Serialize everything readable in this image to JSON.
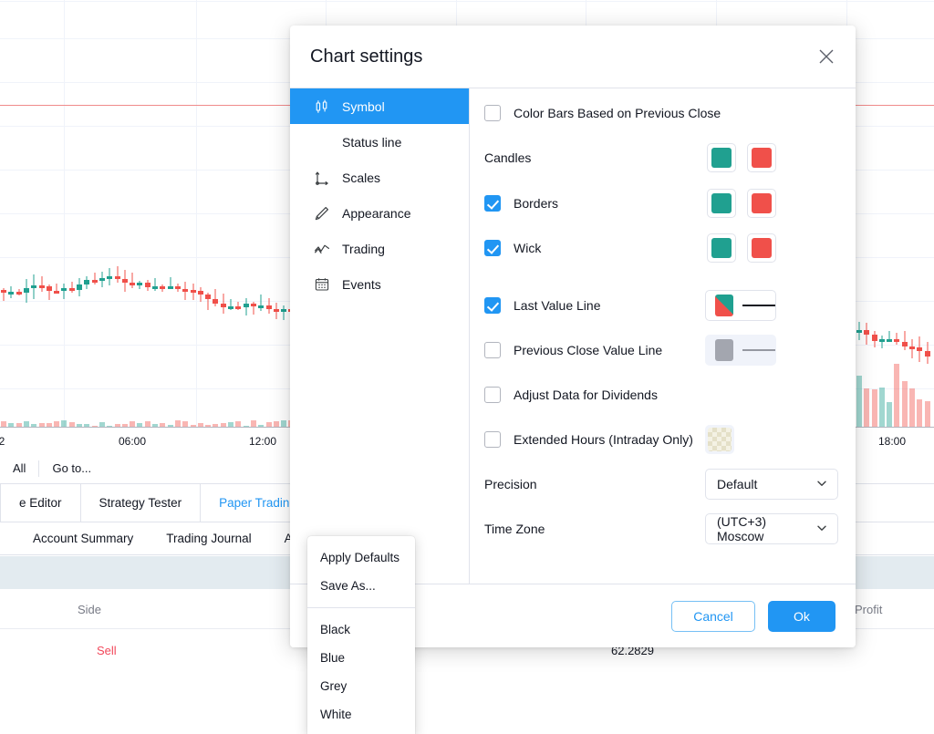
{
  "background": {
    "chart": {
      "x_axis_labels": [
        "2",
        "06:00",
        "12:00",
        "18:00"
      ],
      "prev_close_line_color": "#f08a8a",
      "up_color": "#20a090",
      "down_color": "#f0504a",
      "grid_color": "#f0f3fa"
    },
    "toolbar": {
      "items": [
        "All",
        "Go to..."
      ]
    },
    "tabs": [
      {
        "label": "e Editor",
        "active": false,
        "dot": false
      },
      {
        "label": "Strategy Tester",
        "active": false,
        "dot": false
      },
      {
        "label": "Paper Trading",
        "active": true,
        "dot": true
      }
    ],
    "subtabs": [
      "Account Summary",
      "Trading Journal",
      "A"
    ],
    "table": {
      "headers": [
        "Side",
        "Profit"
      ],
      "row": {
        "side": "Sell",
        "value": "62.2829"
      }
    }
  },
  "dialog": {
    "title": "Chart settings",
    "close_icon": "close-icon",
    "nav": [
      {
        "label": "Symbol",
        "icon": "candlestick-icon",
        "active": true
      },
      {
        "label": "Status line",
        "icon": "status-line-icon",
        "active": false
      },
      {
        "label": "Scales",
        "icon": "scales-axis-icon",
        "active": false
      },
      {
        "label": "Appearance",
        "icon": "pencil-icon",
        "active": false
      },
      {
        "label": "Trading",
        "icon": "zigzag-icon",
        "active": false
      },
      {
        "label": "Events",
        "icon": "calendar-icon",
        "active": false
      }
    ],
    "fields": {
      "color_bars": {
        "label": "Color Bars Based on Previous Close",
        "checked": false
      },
      "candles": {
        "label": "Candles",
        "up_color": "#20a090",
        "down_color": "#f0504a"
      },
      "borders": {
        "label": "Borders",
        "checked": true,
        "up_color": "#20a090",
        "down_color": "#f0504a"
      },
      "wick": {
        "label": "Wick",
        "checked": true,
        "up_color": "#20a090",
        "down_color": "#f0504a"
      },
      "last_value_line": {
        "label": "Last Value Line",
        "checked": true,
        "up_color": "#20a090",
        "down_color": "#f0504a",
        "line_color": "#131722"
      },
      "previous_close_value_line": {
        "label": "Previous Close Value Line",
        "checked": false,
        "color": "#a3a6af",
        "line_color": "#9598a1"
      },
      "adjust_dividends": {
        "label": "Adjust Data for Dividends",
        "checked": false
      },
      "extended_hours": {
        "label": "Extended Hours (Intraday Only)",
        "checked": false,
        "swatch": "transparent-checker"
      },
      "precision": {
        "label": "Precision",
        "value": "Default"
      },
      "time_zone": {
        "label": "Time Zone",
        "value": "(UTC+3) Moscow"
      }
    },
    "footer": {
      "cancel_label": "Cancel",
      "ok_label": "Ok",
      "accent_color": "#2196f3"
    }
  },
  "context_menu": {
    "group_1": [
      "Apply Defaults",
      "Save As..."
    ],
    "group_2": [
      "Black",
      "Blue",
      "Grey",
      "White"
    ]
  }
}
